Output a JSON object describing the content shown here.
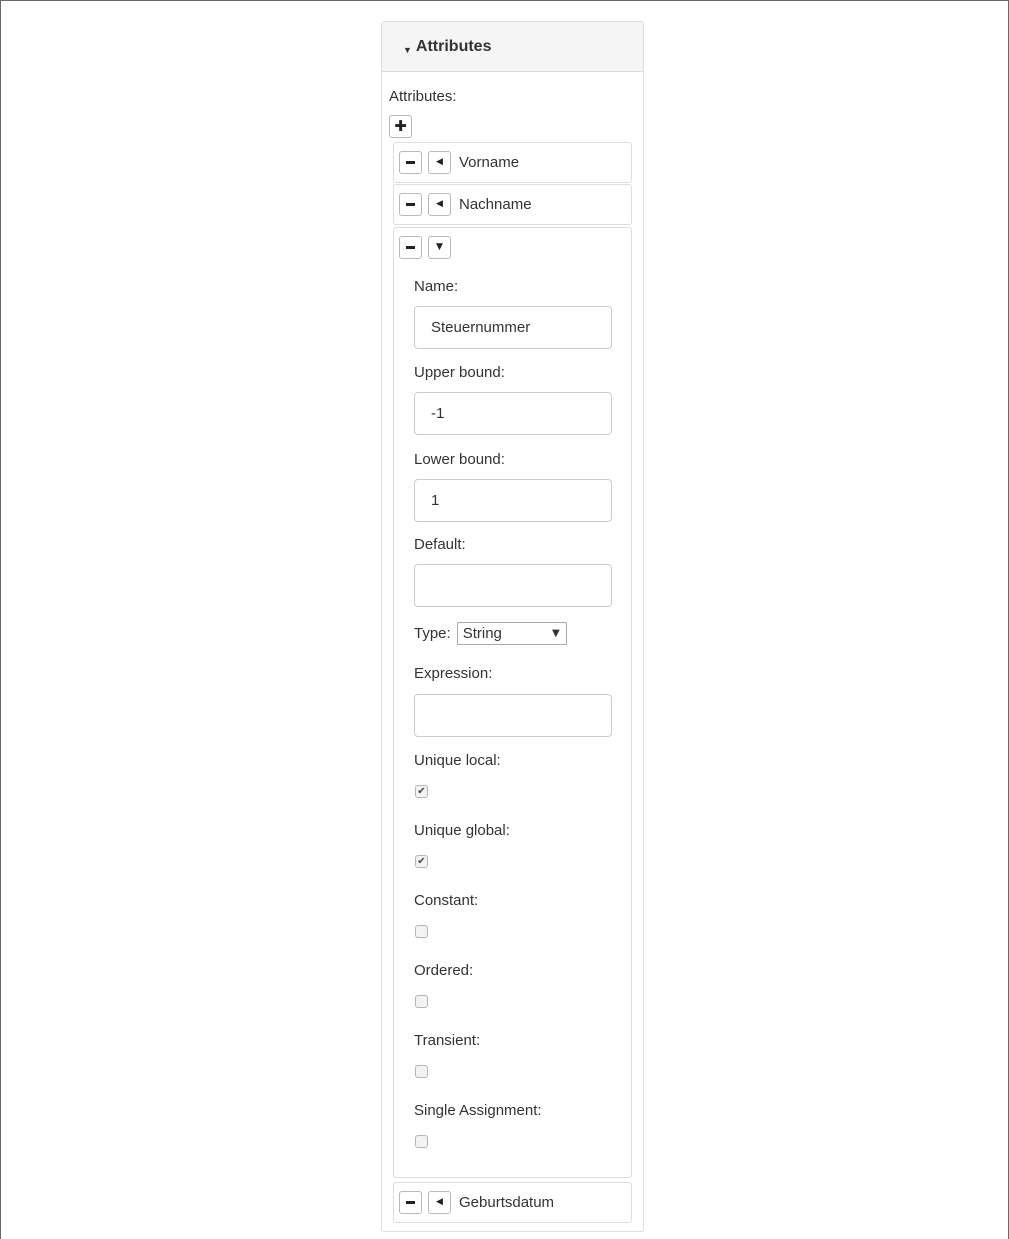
{
  "panel": {
    "title": "Attributes",
    "section_label": "Attributes:"
  },
  "attributes_collapsed_top": [
    {
      "name": "Vorname"
    },
    {
      "name": "Nachname"
    }
  ],
  "expanded": {
    "name_label": "Name:",
    "name_value": "Steuernummer",
    "upper_label": "Upper bound:",
    "upper_value": "-1",
    "lower_label": "Lower bound:",
    "lower_value": "1",
    "default_label": "Default:",
    "default_value": "",
    "type_label": "Type:",
    "type_value": "String",
    "expression_label": "Expression:",
    "expression_value": "",
    "unique_local_label": "Unique local:",
    "unique_local": true,
    "unique_global_label": "Unique global:",
    "unique_global": true,
    "constant_label": "Constant:",
    "constant": false,
    "ordered_label": "Ordered:",
    "ordered": false,
    "transient_label": "Transient:",
    "transient": false,
    "single_assignment_label": "Single Assignment:",
    "single_assignment": false
  },
  "attributes_collapsed_bottom": [
    {
      "name": "Geburtsdatum"
    }
  ],
  "icons": {
    "plus": "plus-icon",
    "minus": "minus-icon",
    "collapsed": "triangle-left-icon",
    "expanded": "triangle-down-icon",
    "dropdown": "triangle-down-icon"
  }
}
